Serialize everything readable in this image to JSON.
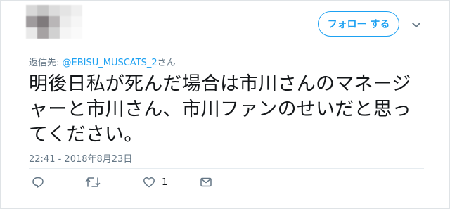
{
  "author": {
    "identity_hidden": true,
    "mosaic_colors": [
      "#d8d8d8",
      "#c6c6c6",
      "#dcdcdc",
      "#e4e4e4",
      "#efefef",
      "#9f9b9d",
      "#7f7a7c",
      "#b9b6b7",
      "#ececec",
      "#f6f6f6",
      "#e9e9e9",
      "#a6a2a3",
      "#d1d1d1",
      "#f5f5f5",
      "#fafafa"
    ]
  },
  "follow_button": {
    "label": "フォロー する"
  },
  "more_menu": {
    "icon": "chevron-down-icon"
  },
  "reply_to": {
    "prefix": "返信先: ",
    "handle": "@EBISU_MUSCATS_2",
    "suffix": "さん"
  },
  "tweet": {
    "text": "明後日私が死んだ場合は市川さんのマネージャーと市川さん、市川ファンのせいだと思ってください。",
    "timestamp": "22:41 - 2018年8月23日"
  },
  "actions": {
    "reply": {
      "icon": "reply-icon"
    },
    "retweet": {
      "icon": "retweet-icon"
    },
    "like": {
      "icon": "heart-icon",
      "count": "1"
    },
    "dm": {
      "icon": "envelope-icon"
    }
  },
  "colors": {
    "accent": "#1da1f2",
    "text": "#14171a",
    "muted": "#657786",
    "border": "#dfe3e6"
  }
}
